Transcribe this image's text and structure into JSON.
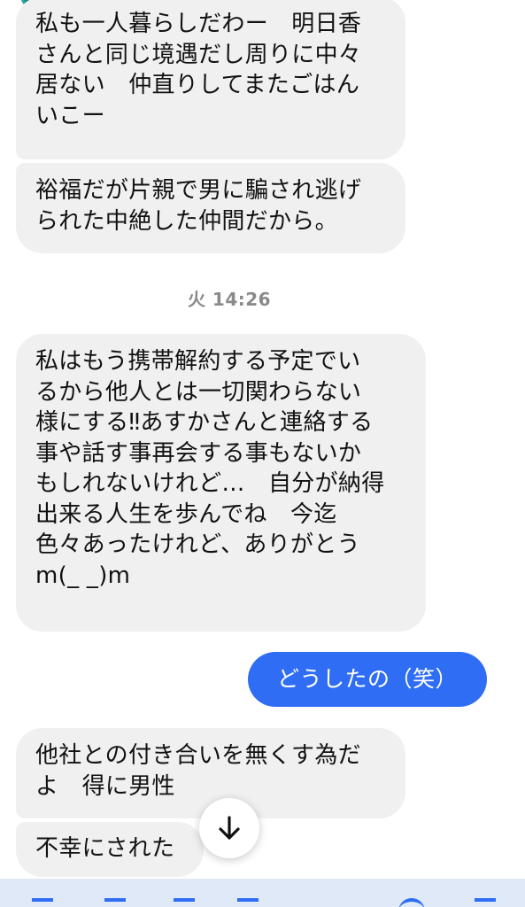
{
  "messages": [
    {
      "id": "m1",
      "lines": [
        "私も一人暮らしだわー　明日香",
        "さんと同じ境遇だし周りに中々",
        "居ない　仲直りしてまたごはん",
        "いこー"
      ]
    },
    {
      "id": "m2",
      "lines": [
        "裕福だが片親で男に騙され逃げ",
        "られた中絶した仲間だから。"
      ]
    },
    {
      "id": "m3",
      "lines": [
        "私はもう携帯解約する予定でい",
        "るから他人とは一切関わらない",
        "様にする‼あすかさんと連絡する",
        "事や話す事再会する事もないか",
        "もしれないけれど…　自分が納得",
        "出来る人生を歩んでね　今迄",
        "色々あったけれど、ありがとう",
        "m(_ _)m"
      ]
    },
    {
      "id": "m4",
      "lines": [
        "他社との付き合いを無くす為だ",
        "よ　得に男性"
      ]
    },
    {
      "id": "m5",
      "lines": [
        "不幸にされた"
      ]
    }
  ],
  "timestamp": "火 14:26",
  "outgoing": {
    "text": "どうしたの（笑）"
  },
  "icons": {
    "scroll_down": "arrow-down-icon"
  },
  "colors": {
    "incoming_bubble": "#f0f0f0",
    "outgoing_bubble": "#2f6df4",
    "timestamp": "#8a8a8a"
  }
}
